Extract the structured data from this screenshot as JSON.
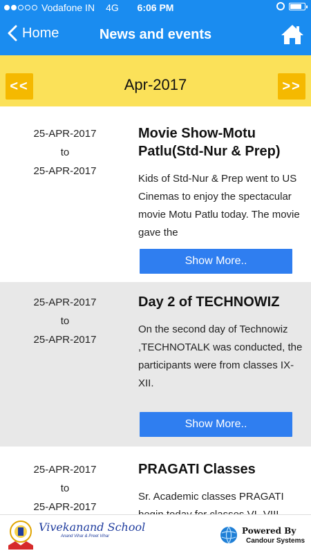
{
  "status_bar": {
    "carrier": "Vodafone IN",
    "network": "4G",
    "time": "6:06 PM",
    "signal_bars_filled": 2,
    "signal_bars_total": 5,
    "battery_level": 0.8
  },
  "nav": {
    "back_label": "Home",
    "title": "News and events",
    "home_icon": "home-icon"
  },
  "month_bar": {
    "prev_label": "<<",
    "next_label": ">>",
    "month": "Apr-2017"
  },
  "events": [
    {
      "from": "25-APR-2017",
      "to_word": "to",
      "to": "25-APR-2017",
      "title": "Movie Show-Motu Patlu(Std-Nur & Prep)",
      "description": "Kids of Std-Nur & Prep went to US Cinemas to enjoy the spectacular movie Motu Patlu today. The movie gave the",
      "button": "Show More.."
    },
    {
      "from": "25-APR-2017",
      "to_word": "to",
      "to": "25-APR-2017",
      "title": "Day 2 of TECHNOWIZ",
      "description": "On the second day of Technowiz ,TECHNOTALK was conducted, the participants were from classes IX-XII.",
      "button": "Show More.."
    },
    {
      "from": "25-APR-2017",
      "to_word": "to",
      "to": "25-APR-2017",
      "title": "PRAGATI Classes",
      "description": "Sr. Academic classes PRAGATI begin today for classes VI -VIII"
    }
  ],
  "footer": {
    "school_name": "Vivekanand School",
    "school_sub": "Anand Vihar & Preet Vihar",
    "powered_by": "Powered By",
    "company": "Candour Systems"
  },
  "colors": {
    "nav_blue": "#1a8cf0",
    "month_yellow": "#fbe159",
    "arrow_orange": "#f5b900",
    "button_blue": "#2f7ef0"
  }
}
